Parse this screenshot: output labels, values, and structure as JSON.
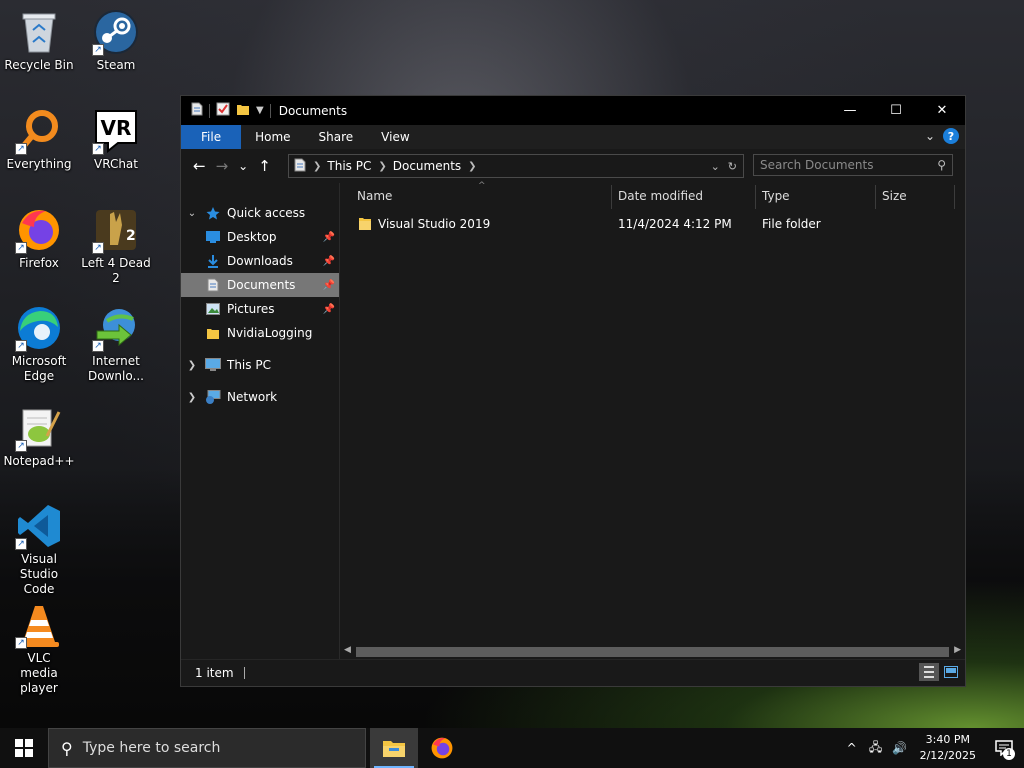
{
  "desktop": {
    "icons": [
      {
        "label": "Recycle Bin",
        "icon": "recycle-bin-icon"
      },
      {
        "label": "Steam",
        "icon": "steam-icon"
      },
      {
        "label": "Everything",
        "icon": "everything-icon"
      },
      {
        "label": "VRChat",
        "icon": "vrchat-icon"
      },
      {
        "label": "Firefox",
        "icon": "firefox-icon"
      },
      {
        "label": "Left 4 Dead 2",
        "icon": "left-4-dead-2-icon"
      },
      {
        "label": "Microsoft Edge",
        "icon": "edge-icon"
      },
      {
        "label": "Internet Downlo...",
        "icon": "internet-download-manager-icon"
      },
      {
        "label": "Notepad++",
        "icon": "notepad-plus-plus-icon"
      },
      {
        "label": "Visual Studio Code",
        "icon": "vscode-icon"
      },
      {
        "label": "VLC media player",
        "icon": "vlc-icon"
      }
    ],
    "vrchat_glyph": "VR"
  },
  "explorer": {
    "title": "Documents",
    "caption": {
      "minimize": "—",
      "maximize": "☐",
      "close": "✕"
    },
    "ribbon": {
      "tabs": [
        "File",
        "Home",
        "Share",
        "View"
      ],
      "help": "?"
    },
    "nav": {
      "back": "←",
      "forward": "→",
      "recent": "⌄",
      "up": "↑"
    },
    "address": {
      "crumbs": [
        "This PC",
        "Documents"
      ]
    },
    "search": {
      "placeholder": "Search Documents"
    },
    "navpane": {
      "quick_access": "Quick access",
      "pinned": [
        {
          "label": "Desktop",
          "pinned": true
        },
        {
          "label": "Downloads",
          "pinned": true
        },
        {
          "label": "Documents",
          "pinned": true,
          "selected": true
        },
        {
          "label": "Pictures",
          "pinned": true
        },
        {
          "label": "NvidiaLogging",
          "pinned": false
        }
      ],
      "this_pc": "This PC",
      "network": "Network"
    },
    "columns": [
      "Name",
      "Date modified",
      "Type",
      "Size"
    ],
    "files": [
      {
        "name": "Visual Studio 2019",
        "date_modified": "11/4/2024 4:12 PM",
        "type": "File folder",
        "size": ""
      }
    ],
    "status": {
      "count": "1 item"
    }
  },
  "taskbar": {
    "search_placeholder": "Type here to search",
    "apps": [
      "file-explorer",
      "firefox"
    ],
    "clock": {
      "time": "3:40 PM",
      "date": "2/12/2025"
    },
    "notifications": "1"
  },
  "colors": {
    "accent": "#1a62b8",
    "folder": "#f4c542"
  }
}
